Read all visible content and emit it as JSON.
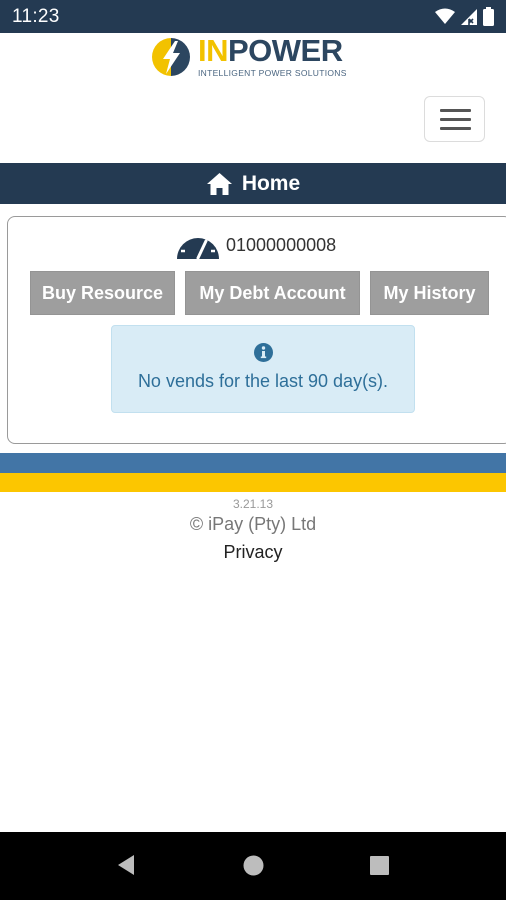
{
  "status_bar": {
    "time": "11:23",
    "icons": [
      "wifi-icon",
      "cellular-signal-icon",
      "battery-icon"
    ]
  },
  "header": {
    "logo_in": "IN",
    "logo_power": "POWER",
    "logo_tagline": "INTELLIGENT POWER SOLUTIONS",
    "menu_icon": "hamburger-menu-icon"
  },
  "page_bar": {
    "icon": "home-icon",
    "title": "Home"
  },
  "meter": {
    "icon": "meter-gauge-icon",
    "number": "01000000008"
  },
  "actions": {
    "buy_resource": "Buy Resource",
    "my_debt_account": "My Debt Account",
    "my_history": "My History"
  },
  "info": {
    "icon": "info-icon",
    "message": "No vends for the last 90 day(s)."
  },
  "footer": {
    "version": "3.21.13",
    "copyright": "© iPay (Pty) Ltd",
    "privacy": "Privacy"
  },
  "colors": {
    "navy": "#243a52",
    "stripe_blue": "#4275a6",
    "stripe_gold": "#fcc600",
    "button_gray": "#9e9e9e",
    "info_bg": "#d9ecf6",
    "info_text": "#2e6f99"
  }
}
